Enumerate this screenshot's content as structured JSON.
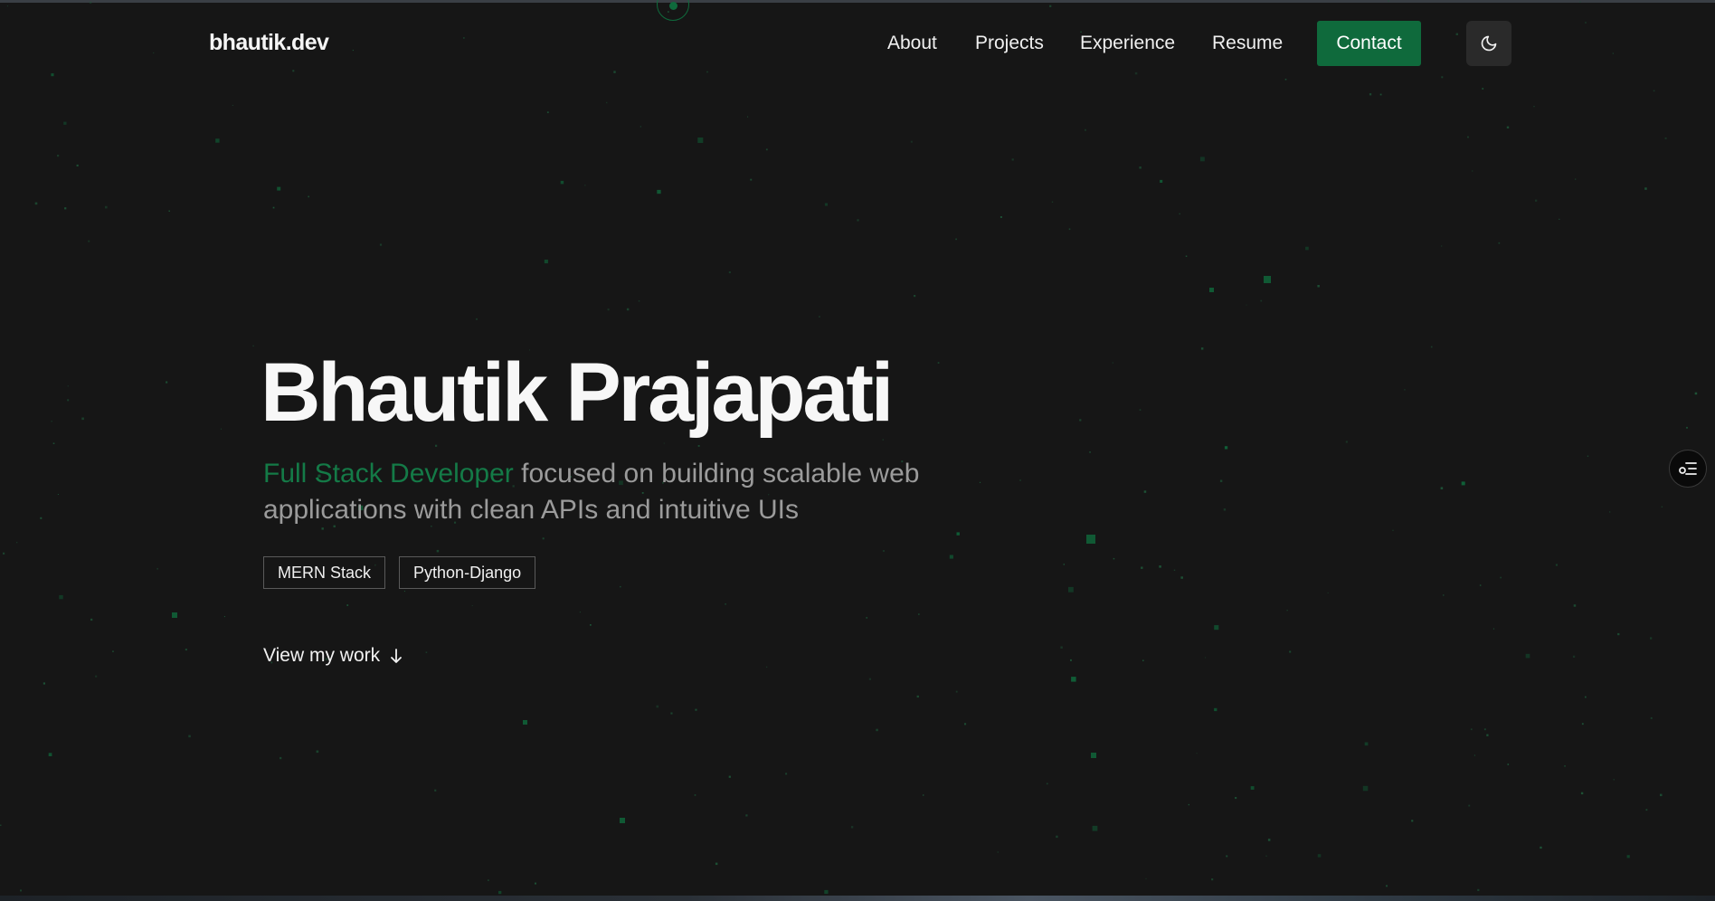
{
  "colors": {
    "background": "#161616",
    "accent": "#0f6a3c",
    "accent_text": "#147a47",
    "muted_text": "#9b9b9b"
  },
  "header": {
    "brand": "bhautik.dev",
    "nav": [
      {
        "label": "About"
      },
      {
        "label": "Projects"
      },
      {
        "label": "Experience"
      },
      {
        "label": "Resume"
      }
    ],
    "contact_label": "Contact",
    "theme_icon": "moon-icon"
  },
  "hero": {
    "name": "Bhautik Prajapati",
    "role": "Full Stack Developer",
    "description": "focused on building scalable web applications with clean APIs and intuitive UIs",
    "tags": [
      "MERN Stack",
      "Python-Django"
    ],
    "cta_label": "View my work",
    "cta_icon": "arrow-down-icon"
  },
  "side_widget": {
    "icon": "settings-list-icon"
  }
}
